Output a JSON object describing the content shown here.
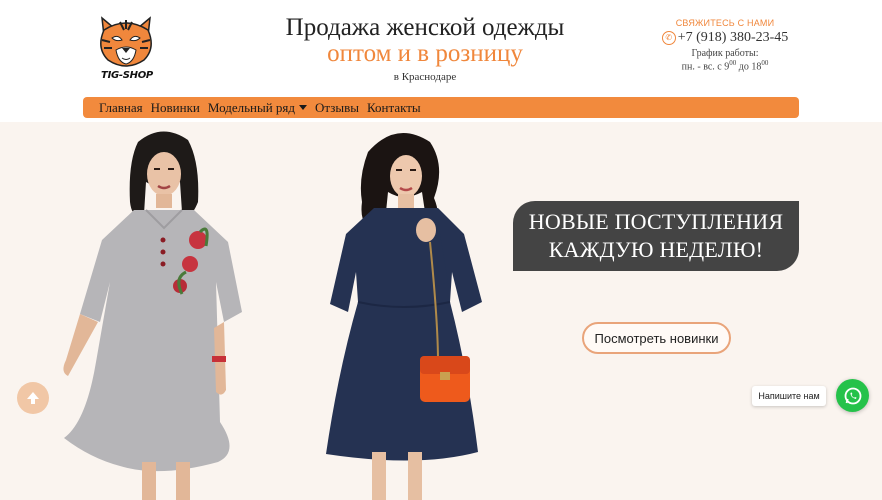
{
  "brand": {
    "logo_text": "TIG-SHOP",
    "accent": "#f0873c"
  },
  "header": {
    "title_line1": "Продажа женской одежды",
    "title_line2": "оптом и в розницу",
    "title_line3": "в Краснодаре"
  },
  "contact": {
    "label": "СВЯЖИТЕСЬ С НАМИ",
    "phone": "+7 (918) 380-23-45",
    "hours_label": "График работы:",
    "hours_prefix": "пн. - вс. с 9",
    "hours_sup1": "00",
    "hours_mid": " до 18",
    "hours_sup2": "00"
  },
  "nav": {
    "items": [
      "Главная",
      "Новинки",
      "Модельный ряд",
      "Отзывы",
      "Контакты"
    ]
  },
  "hero": {
    "headline_line1": "НОВЫЕ ПОСТУПЛЕНИЯ",
    "headline_line2": "КАЖДУЮ НЕДЕЛЮ!",
    "cta_label": "Посмотреть новинки",
    "background": "#faf4ef"
  },
  "chat": {
    "label": "Напишите нам",
    "color": "#25c24a"
  },
  "icons": [
    "tiger-logo-icon",
    "phone-icon",
    "chevron-down-icon",
    "arrow-up-icon",
    "whatsapp-icon"
  ]
}
